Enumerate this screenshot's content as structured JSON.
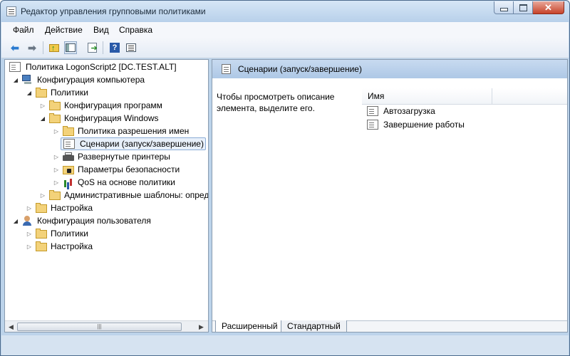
{
  "window": {
    "title": "Редактор управления групповыми политиками"
  },
  "menu": [
    "Файл",
    "Действие",
    "Вид",
    "Справка"
  ],
  "toolbar": {
    "icons": [
      "back-arrow-icon",
      "forward-arrow-icon",
      "folder-up-icon",
      "show-hide-tree-icon",
      "export-list-icon",
      "help-icon",
      "properties-icon"
    ]
  },
  "tree": {
    "root": "Политика LogonScript2 [DC.TEST.ALT]",
    "computer_config": "Конфигурация компьютера",
    "policies": "Политики",
    "software_settings": "Конфигурация программ",
    "windows_settings": "Конфигурация Windows",
    "name_resolution_policy": "Политика разрешения имен",
    "scripts": "Сценарии (запуск/завершение)",
    "deployed_printers": "Развернутые принтеры",
    "security_settings": "Параметры безопасности",
    "qos_policy": "QoS на основе политики",
    "admin_templates": "Административные шаблоны: опред",
    "preferences": "Настройка",
    "user_config": "Конфигурация пользователя",
    "user_policies": "Политики",
    "user_preferences": "Настройка"
  },
  "right_pane": {
    "header_title": "Сценарии (запуск/завершение)",
    "description": "Чтобы просмотреть описание элемента, выделите его.",
    "column_name": "Имя",
    "items": [
      "Автозагрузка",
      "Завершение работы"
    ]
  },
  "tabs": {
    "extended": "Расширенный",
    "standard": "Стандартный"
  }
}
